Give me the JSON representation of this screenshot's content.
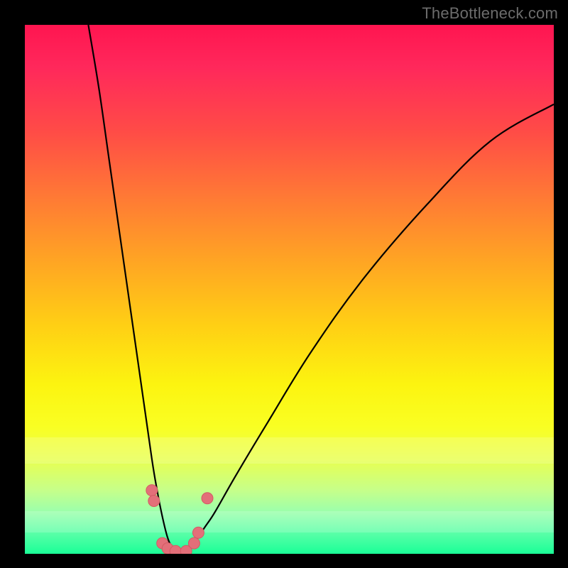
{
  "watermark": "TheBottleneck.com",
  "colors": {
    "frame": "#000000",
    "gradient_top": "#ff1550",
    "gradient_mid": "#ffd014",
    "gradient_bottom": "#1aff97",
    "curve": "#000000",
    "marker_fill": "#e36f79",
    "marker_stroke": "#d35a64"
  },
  "chart_data": {
    "type": "line",
    "title": "",
    "xlabel": "",
    "ylabel": "",
    "xlim": [
      0,
      100
    ],
    "ylim": [
      0,
      100
    ],
    "notes": "Two curves descending to a common minimum near the bottom; left curve is steep, right curve is broad. Markers cluster near the minimum.",
    "series": [
      {
        "name": "left-curve",
        "x": [
          12,
          14,
          16,
          18,
          20,
          22,
          24,
          25,
          26,
          27,
          28,
          29
        ],
        "y": [
          100,
          88,
          74,
          60,
          46,
          32,
          18,
          12,
          7,
          3,
          1,
          0
        ]
      },
      {
        "name": "right-curve",
        "x": [
          30,
          31,
          32,
          34,
          36,
          40,
          46,
          54,
          64,
          76,
          88,
          100
        ],
        "y": [
          0,
          1,
          2,
          5,
          8,
          15,
          25,
          38,
          52,
          66,
          78,
          85
        ]
      }
    ],
    "markers": [
      {
        "x": 24.0,
        "y": 12.0
      },
      {
        "x": 24.4,
        "y": 10.0
      },
      {
        "x": 26.0,
        "y": 2.0
      },
      {
        "x": 27.0,
        "y": 1.0
      },
      {
        "x": 28.5,
        "y": 0.5
      },
      {
        "x": 30.5,
        "y": 0.5
      },
      {
        "x": 32.0,
        "y": 2.0
      },
      {
        "x": 32.8,
        "y": 4.0
      },
      {
        "x": 34.5,
        "y": 10.5
      }
    ],
    "gloss_bands": [
      {
        "y_pct": 78,
        "height_pct": 5
      },
      {
        "y_pct": 92,
        "height_pct": 4
      }
    ]
  }
}
